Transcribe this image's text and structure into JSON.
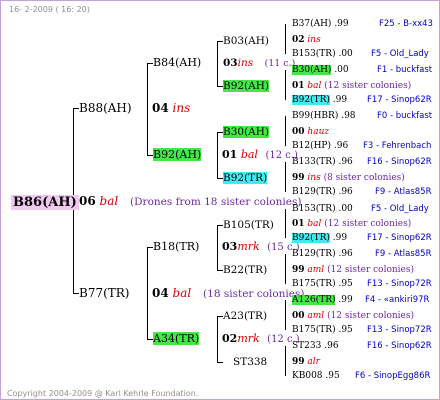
{
  "header": "16- 2-2009 ( 16: 20)",
  "footer": "Copyright 2004-2009 @ Karl Kehrle Foundation.",
  "root": {
    "name": "B86(AH)",
    "year": "06",
    "mark": "bal",
    "note": "(Drones from 18 sister colonies)"
  },
  "sire": {
    "name": "B88(AH)",
    "year": "04",
    "mark": "ins"
  },
  "dam": {
    "name": "B77(TR)",
    "year": "04",
    "mark": "bal",
    "note": "(18 sister colonies)"
  },
  "gen3": {
    "b84": {
      "name": "B84(AH)"
    },
    "b92": {
      "name": "B92(AH)",
      "year": "01",
      "mark": "bal",
      "note": "(12 c.)"
    },
    "b18": {
      "name": "B18(TR)",
      "year": "03",
      "mark": "mrk",
      "note": "(15 c.)"
    },
    "a34": {
      "name": "A34(TR)",
      "year": "02",
      "mark": "mrk",
      "note": "(12 c.)"
    }
  },
  "gen4": {
    "b03": {
      "name": "B03(AH)",
      "year": "03",
      "mark": "ins",
      "note": "(11 c.)"
    },
    "b92ah": {
      "name": "B92(AH)"
    },
    "b30": {
      "name": "B30(AH)",
      "year": "00",
      "mark": "hauz"
    },
    "b92tr": {
      "name": "B92(TR)",
      "year": "99",
      "mark": "ins",
      "note": "(8 sister colonies)"
    },
    "b105": {
      "name": "B105(TR)",
      "year": "01",
      "mark": "bal",
      "note": "(12 sister colonies)"
    },
    "b22": {
      "name": "B22(TR)",
      "year": "99",
      "mark": "aml",
      "note": "(12 sister colonies)"
    },
    "a23": {
      "name": "A23(TR)",
      "year": "00",
      "mark": "aml",
      "note": "(12 sister colonies)"
    },
    "st338": {
      "name": "ST338",
      "year": "99",
      "mark": "alr"
    }
  },
  "leaves": [
    {
      "name": "B37(AH)",
      "val": ".99",
      "src": "F25 - B-xx43"
    },
    {
      "name": "02",
      "mark": "ins"
    },
    {
      "name": "B153(TR)",
      "val": ".00",
      "src": "F5 - Old_Lady"
    },
    {
      "name": "B30(AH)",
      "val": ".00",
      "src": "F1 - buckfast"
    },
    {
      "name": "01",
      "mark": "bal",
      "note": "(12 sister colonies)"
    },
    {
      "name": "B92(TR)",
      "val": ".99",
      "src": "F17 - Sinop62R"
    },
    {
      "name": "B99(HBR)",
      "val": ".98",
      "src": "F0 - buckfast"
    },
    {
      "name": "B12(HP)",
      "val": ".96",
      "src": "F3 - Fehrenbach"
    },
    {
      "name": "B133(TR)",
      "val": ".96",
      "src": "F16 - Sinop62R"
    },
    {
      "name": "B129(TR)",
      "val": ".96",
      "src": "F9 - Atlas85R"
    },
    {
      "name": "B153(TR)",
      "val": ".00",
      "src": "F5 - Old_Lady"
    },
    {
      "name": "B92(TR)",
      "val": ".99",
      "src": "F17 - Sinop62R"
    },
    {
      "name": "B129(TR)",
      "val": ".96",
      "src": "F9 - Atlas85R"
    },
    {
      "name": "B175(TR)",
      "val": ".95",
      "src": "F13 - Sinop72R"
    },
    {
      "name": "A126(TR)",
      "val": ".99",
      "src": "F4 - «ankiri97R"
    },
    {
      "name": "B175(TR)",
      "val": ".95",
      "src": "F13 - Sinop72R"
    },
    {
      "name": "ST233",
      "val": ".96",
      "src": "F16 - Sinop62R"
    },
    {
      "name": "KB008",
      "val": ".95",
      "src": "F6 - SinopEgg86R"
    }
  ]
}
